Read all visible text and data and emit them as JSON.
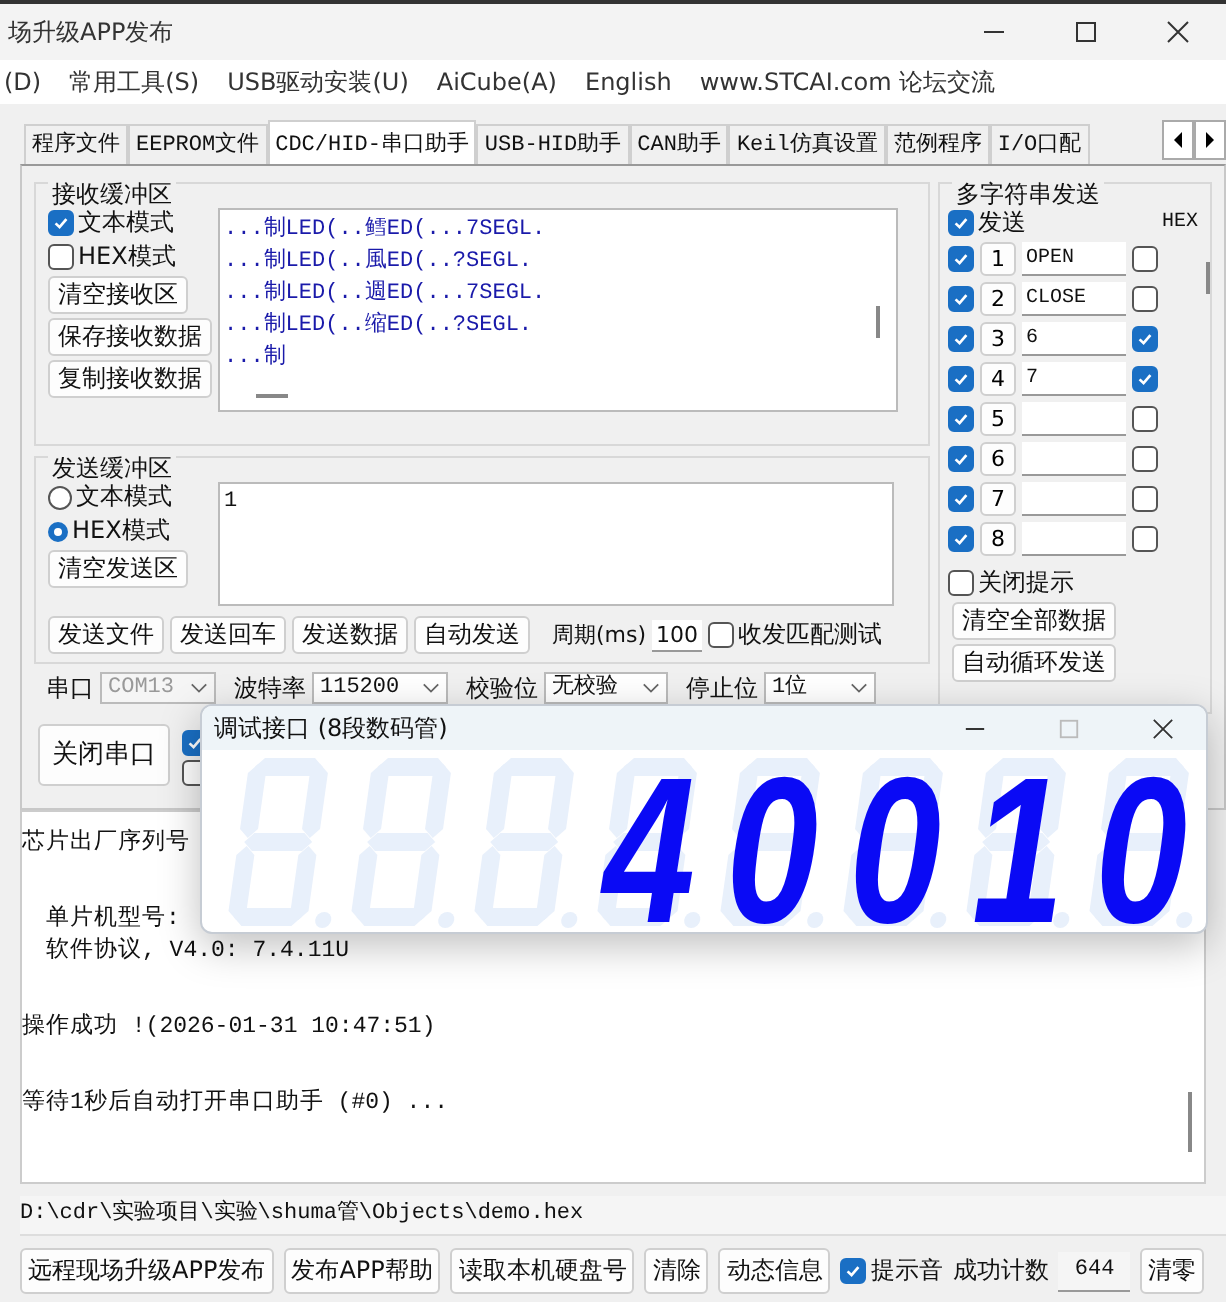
{
  "window": {
    "title": "场升级APP发布"
  },
  "menu": [
    "(D)",
    "常用工具(S)",
    "USB驱动安装(U)",
    "AiCube(A)",
    "English",
    "www.STCAI.com 论坛交流"
  ],
  "tabs": [
    {
      "label": "程序文件",
      "selected": false
    },
    {
      "label": "EEPROM文件",
      "selected": false
    },
    {
      "label": "CDC/HID-串口助手",
      "selected": true
    },
    {
      "label": "USB-HID助手",
      "selected": false
    },
    {
      "label": "CAN助手",
      "selected": false
    },
    {
      "label": "Keil仿真设置",
      "selected": false
    },
    {
      "label": "范例程序",
      "selected": false
    },
    {
      "label": "I/O口配",
      "selected": false
    }
  ],
  "receive": {
    "title": "接收缓冲区",
    "modes": [
      {
        "label": "文本模式",
        "checked": true
      },
      {
        "label": "HEX模式",
        "checked": false
      }
    ],
    "buttons": [
      "清空接收区",
      "保存接收数据",
      "复制接收数据"
    ],
    "lines": [
      "...制LED(..鳕ED(...7SEGL.",
      "...制LED(..風ED(..?SEGL.",
      "...制LED(..週ED(...7SEGL.",
      "...制LED(..缩ED(..?SEGL.",
      "...制"
    ]
  },
  "send": {
    "title": "发送缓冲区",
    "modes": [
      {
        "label": "文本模式",
        "selected": false
      },
      {
        "label": "HEX模式",
        "selected": true
      }
    ],
    "clear_button": "清空发送区",
    "value": "1",
    "buttons": [
      "发送文件",
      "发送回车",
      "发送数据",
      "自动发送"
    ],
    "period_label": "周期(ms)",
    "period": "100",
    "match_test": {
      "label": "收发匹配测试",
      "checked": false
    }
  },
  "serial": {
    "port_label": "串口",
    "port": "COM13",
    "port_disabled": true,
    "baud_label": "波特率",
    "baud": "115200",
    "parity_label": "校验位",
    "parity": "无校验",
    "stop_label": "停止位",
    "stop": "1位",
    "close_button": "关闭串口",
    "options": [
      {
        "checked": true
      },
      {
        "checked": false
      }
    ]
  },
  "multi_send": {
    "title": "多字符串发送",
    "send_all": {
      "label": "发送",
      "checked": true
    },
    "hex_label": "HEX",
    "rows": [
      {
        "enabled": true,
        "number": "1",
        "value": "OPEN",
        "hex": false
      },
      {
        "enabled": true,
        "number": "2",
        "value": "CLOSE",
        "hex": false
      },
      {
        "enabled": true,
        "number": "3",
        "value": "6",
        "hex": true
      },
      {
        "enabled": true,
        "number": "4",
        "value": "7",
        "hex": true
      },
      {
        "enabled": true,
        "number": "5",
        "hex": false
      },
      {
        "enabled": true,
        "number": "6",
        "hex": false
      },
      {
        "enabled": true,
        "number": "7",
        "hex": false
      },
      {
        "enabled": true,
        "number": "8",
        "hex": false
      }
    ],
    "close_hint": {
      "label": "关闭提示",
      "checked": false
    },
    "buttons": [
      "清空全部数据",
      "自动循环发送"
    ]
  },
  "debug_window": {
    "title": "调试接口 (8段数码管)",
    "digits": [
      "4",
      "0",
      "0",
      "1",
      "0"
    ]
  },
  "log": {
    "lines": [
      {
        "text": "芯片出厂序列号",
        "indent": false,
        "gap_before": false
      },
      {
        "text": "单片机型号:",
        "indent": true,
        "gap_before": true
      },
      {
        "text": "软件协议, V4.0: 7.4.11U",
        "indent": true,
        "gap_before": false
      },
      {
        "text": "操作成功 !(2026-01-31 10:47:51)",
        "indent": false,
        "gap_before": true
      },
      {
        "text": "等待1秒后自动打开串口助手 (#0) ...",
        "indent": false,
        "gap_before": true
      }
    ]
  },
  "file_path": "D:\\cdr\\实验项目\\实验\\shuma管\\Objects\\demo.hex",
  "footer": {
    "buttons": [
      "远程现场升级APP发布",
      "发布APP帮助",
      "读取本机硬盘号",
      "清除",
      "动态信息"
    ],
    "sound": {
      "label": "提示音",
      "checked": true
    },
    "count_label": "成功计数",
    "count": "644",
    "reset_button": "清零"
  }
}
